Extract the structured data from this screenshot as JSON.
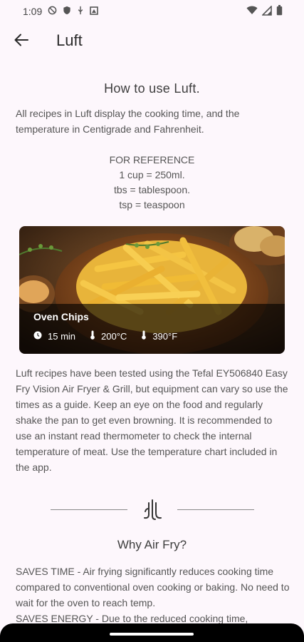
{
  "status_bar": {
    "time": "1:09"
  },
  "app_bar": {
    "title": "Luft"
  },
  "how_to": {
    "title": "How to use Luft.",
    "intro": "All recipes in Luft display the cooking time, and the temperature in Centigrade and Fahrenheit.",
    "reference": [
      "FOR REFERENCE",
      "1 cup = 250ml.",
      "tbs = tablespoon.",
      "tsp = teaspoon"
    ]
  },
  "recipe_card": {
    "title": "Oven Chips",
    "time": "15 min",
    "temp_c": "200°C",
    "temp_f": "390°F"
  },
  "description": "Luft recipes have been tested using the Tefal EY506840 Easy Fry Vision Air Fryer & Grill, but equipment can vary so use the times as a guide. Keep an eye on the food and regularly shake the pan to get even browning. It is recommended to use an instant read thermometer to check the internal temperature of meat. Use the temperature chart included in the app.",
  "why": {
    "title": "Why Air Fry?",
    "saves_time": "SAVES TIME - Air frying significantly reduces cooking time compared to conventional oven cooking or baking. No need to wait for the oven to reach temp.",
    "saves_energy": "SAVES ENERGY - Due to the reduced cooking time,"
  },
  "icons": {
    "status": [
      "no-disturb-icon",
      "shield-icon",
      "usb-icon",
      "screenshot-icon",
      "wifi-icon",
      "signal-icon",
      "battery-icon"
    ],
    "back": "arrow-left-icon",
    "logo": "luft-logo-icon"
  },
  "colors": {
    "background": "#fdf7fc",
    "overlay": "#000000"
  }
}
